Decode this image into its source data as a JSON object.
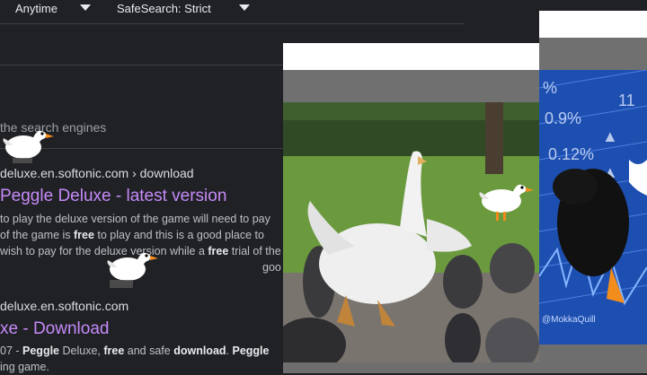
{
  "filters": {
    "time": "Anytime",
    "safesearch": "SafeSearch: Strict"
  },
  "notice": "the search engines",
  "results": [
    {
      "url": "deluxe.en.softonic.com",
      "url_path": "› download",
      "title": "Peggle Deluxe - latest version",
      "lines": [
        [
          "to play the deluxe version of the game will need to pay "
        ],
        [
          "of the game is ",
          {
            "b": "free"
          },
          " to play and this is a good place to"
        ],
        [
          "wish to pay for the deluxe version while a ",
          {
            "b": "free"
          },
          " trial of the"
        ],
        [
          "goo"
        ]
      ]
    },
    {
      "url": "deluxe.en.softonic.com",
      "title": "xe - Download",
      "lines": [
        [
          "07 - ",
          {
            "b": "Peggle"
          },
          " Deluxe, ",
          {
            "b": "free"
          },
          " and safe ",
          {
            "b": "download"
          },
          ". ",
          {
            "b": "Peggle"
          }
        ],
        [
          "ing game."
        ]
      ]
    }
  ],
  "popups": {
    "stock_credit": "@MokkaQuill"
  },
  "colors": {
    "background": "#202124",
    "link_title": "#c58af9",
    "text": "#bdc1c6"
  }
}
